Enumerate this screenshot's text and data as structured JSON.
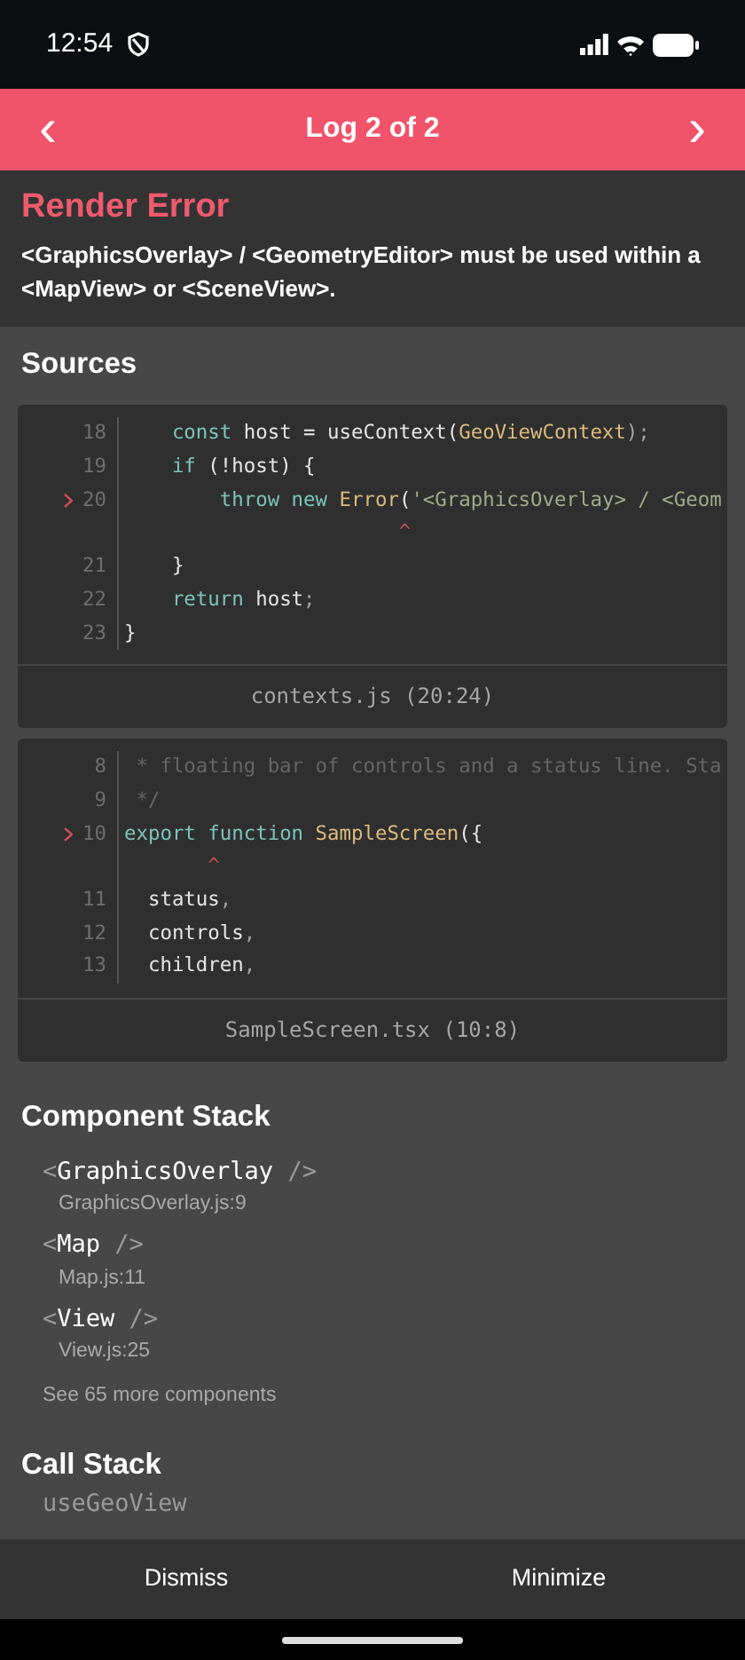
{
  "status_bar": {
    "time": "12:54"
  },
  "header": {
    "title": "Log 2 of 2",
    "prev": "‹",
    "next": "›"
  },
  "error": {
    "title": "Render Error",
    "message": "<GraphicsOverlay> / <GeometryEditor> must be used within a <MapView> or <SceneView>."
  },
  "sources": {
    "title": "Sources",
    "frames": [
      {
        "file": "contexts.js (20:24)",
        "lines": [
          {
            "number": "18",
            "highlighted": false,
            "tokens": [
              {
                "text": "    const",
                "kind": "keyword"
              },
              {
                "text": " host = useContext(",
                "kind": "plain"
              },
              {
                "text": "GeoViewContext",
                "kind": "name"
              },
              {
                "text": ");",
                "kind": "punct"
              }
            ]
          },
          {
            "number": "19",
            "highlighted": false,
            "tokens": [
              {
                "text": "    if",
                "kind": "keyword"
              },
              {
                "text": " (!host) {",
                "kind": "plain"
              }
            ]
          },
          {
            "number": "20",
            "highlighted": true,
            "tokens": [
              {
                "text": "        throw",
                "kind": "keyword"
              },
              {
                "text": " new",
                "kind": "keyword"
              },
              {
                "text": " Error",
                "kind": "name"
              },
              {
                "text": "(",
                "kind": "plain"
              },
              {
                "text": "'<GraphicsOverlay> / <Geom",
                "kind": "string"
              }
            ]
          },
          {
            "highlighted": false,
            "tokens": [
              {
                "text": "                       ^",
                "kind": "caret"
              }
            ]
          },
          {
            "number": "21",
            "highlighted": false,
            "tokens": [
              {
                "text": "    }",
                "kind": "plain"
              }
            ]
          },
          {
            "number": "22",
            "highlighted": false,
            "tokens": [
              {
                "text": "    return",
                "kind": "keyword"
              },
              {
                "text": " host",
                "kind": "plain"
              },
              {
                "text": ";",
                "kind": "punct"
              }
            ]
          },
          {
            "number": "23",
            "highlighted": false,
            "tokens": [
              {
                "text": "}",
                "kind": "plain"
              }
            ]
          }
        ]
      },
      {
        "file": "SampleScreen.tsx (10:8)",
        "lines": [
          {
            "number": "8",
            "highlighted": false,
            "tokens": [
              {
                "text": " * floating bar of controls and a status line. Sta",
                "kind": "comment"
              }
            ]
          },
          {
            "number": "9",
            "highlighted": false,
            "tokens": [
              {
                "text": " */",
                "kind": "comment"
              }
            ]
          },
          {
            "number": "10",
            "highlighted": true,
            "tokens": [
              {
                "text": "export",
                "kind": "keyword"
              },
              {
                "text": " function",
                "kind": "keyword"
              },
              {
                "text": " SampleScreen",
                "kind": "name"
              },
              {
                "text": "({",
                "kind": "plain"
              }
            ]
          },
          {
            "highlighted": false,
            "tokens": [
              {
                "text": "       ^",
                "kind": "caret"
              }
            ]
          },
          {
            "number": "11",
            "highlighted": false,
            "tokens": [
              {
                "text": "  status",
                "kind": "plain"
              },
              {
                "text": ",",
                "kind": "punct"
              }
            ]
          },
          {
            "number": "12",
            "highlighted": false,
            "tokens": [
              {
                "text": "  controls",
                "kind": "plain"
              },
              {
                "text": ",",
                "kind": "punct"
              }
            ]
          },
          {
            "number": "13",
            "highlighted": false,
            "tokens": [
              {
                "text": "  children",
                "kind": "plain"
              },
              {
                "text": ",",
                "kind": "punct"
              }
            ]
          }
        ]
      }
    ]
  },
  "component_stack": {
    "title": "Component Stack",
    "items": [
      {
        "open": "<",
        "name": "GraphicsOverlay",
        "close": " />",
        "file": "GraphicsOverlay.js:9"
      },
      {
        "open": "<",
        "name": "Map",
        "close": " />",
        "file": "Map.js:11"
      },
      {
        "open": "<",
        "name": "View",
        "close": " />",
        "file": "View.js:25"
      }
    ],
    "more": "See 65 more components"
  },
  "call_stack": {
    "title": "Call Stack",
    "items": [
      "useGeoView"
    ]
  },
  "footer": {
    "buttons": [
      "Dismiss",
      "Minimize"
    ]
  }
}
